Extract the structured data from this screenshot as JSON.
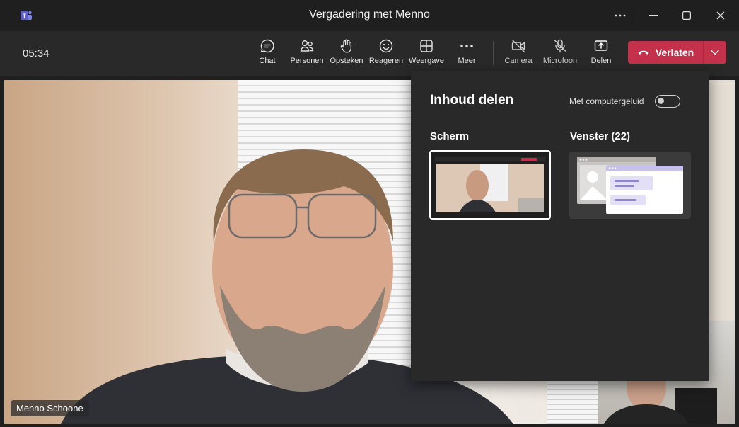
{
  "window": {
    "title": "Vergadering met Menno",
    "more_icon": "ellipsis-icon",
    "controls": [
      "minimize-icon",
      "maximize-icon",
      "close-icon"
    ]
  },
  "toolbar": {
    "timer": "05:34",
    "buttons": [
      {
        "label": "Chat",
        "icon": "chat-icon"
      },
      {
        "label": "Personen",
        "icon": "people-icon"
      },
      {
        "label": "Opsteken",
        "icon": "raise-hand-icon"
      },
      {
        "label": "Reageren",
        "icon": "smiley-icon"
      },
      {
        "label": "Weergave",
        "icon": "grid-icon"
      },
      {
        "label": "Meer",
        "icon": "more-icon"
      },
      {
        "label": "Camera",
        "icon": "camera-off-icon"
      },
      {
        "label": "Microfoon",
        "icon": "mic-off-icon"
      },
      {
        "label": "Delen",
        "icon": "share-icon",
        "active": true
      }
    ],
    "leave_label": "Verlaten",
    "leave_color": "#c4314b",
    "active_underline_color": "#7f85f5"
  },
  "stage": {
    "participant_name": "Menno Schoone"
  },
  "share_panel": {
    "title": "Inhoud delen",
    "audio_label": "Met computergeluid",
    "audio_enabled": false,
    "screen_label": "Scherm",
    "window_label": "Venster (22)"
  }
}
